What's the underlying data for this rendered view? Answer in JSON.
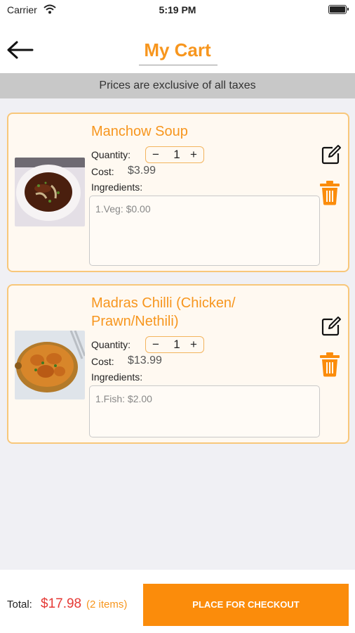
{
  "status_bar": {
    "carrier": "Carrier",
    "time": "5:19 PM"
  },
  "header": {
    "title": "My Cart",
    "back_icon": "arrow-left-icon"
  },
  "notice": "Prices are exclusive of all taxes",
  "cart_items": [
    {
      "name": "Manchow Soup",
      "quantity_label": "Quantity:",
      "quantity": "1",
      "minus": "−",
      "plus": "+",
      "cost_label": "Cost:",
      "cost": "$3.99",
      "ingredients_label": "Ingredients:",
      "ingredients_text": "1.Veg:  $0.00"
    },
    {
      "name": "Madras Chilli (Chicken/ Prawn/Nethili)",
      "quantity_label": "Quantity:",
      "quantity": "1",
      "minus": "−",
      "plus": "+",
      "cost_label": "Cost:",
      "cost": "$13.99",
      "ingredients_label": "Ingredients:",
      "ingredients_text": "1.Fish:  $2.00"
    }
  ],
  "footer": {
    "total_label": "Total:",
    "total_amount": "$17.98",
    "item_count": "(2 items)",
    "checkout_label": "PLACE FOR CHECKOUT"
  },
  "colors": {
    "accent": "#f7961e",
    "total": "#e53935",
    "checkout": "#fb8c0b"
  }
}
